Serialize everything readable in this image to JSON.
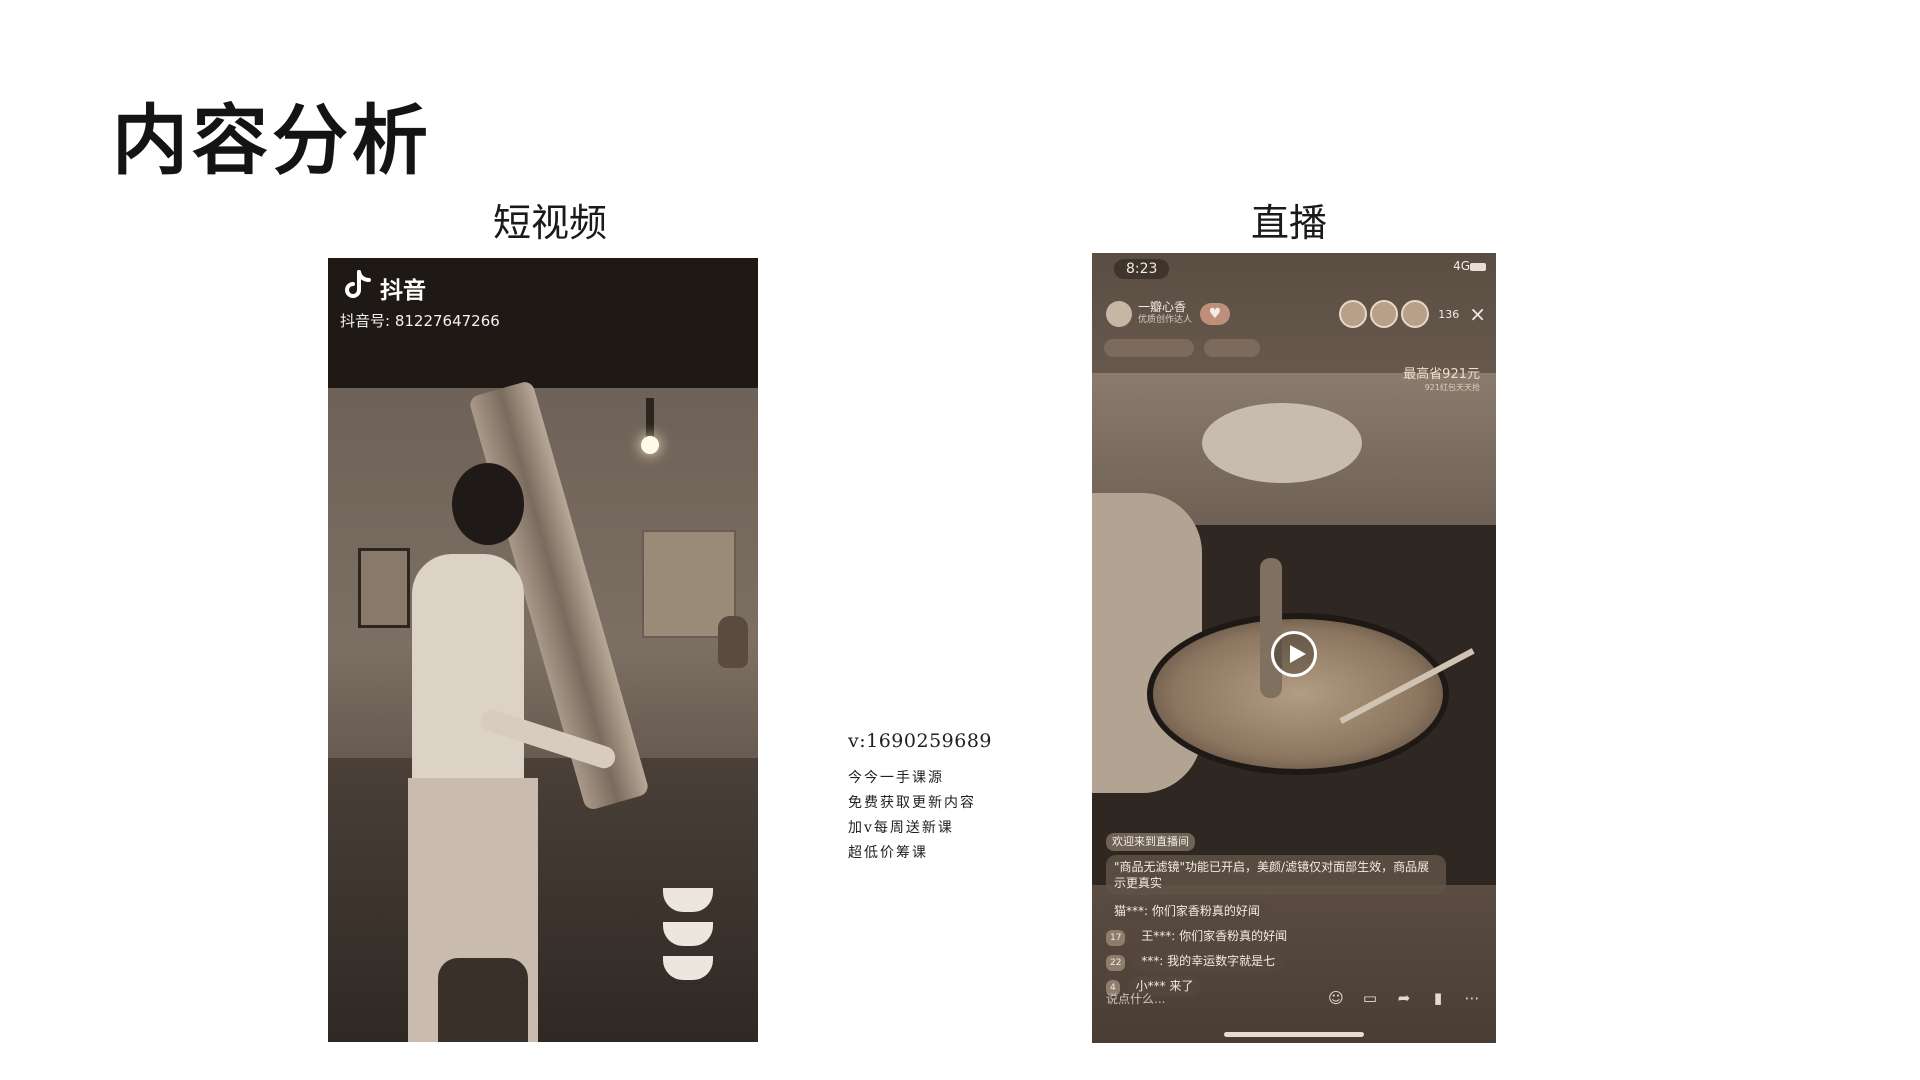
{
  "slide": {
    "title": "内容分析",
    "short_video_label": "短视频",
    "live_label": "直播"
  },
  "short_video": {
    "brand": "抖音",
    "account_id": "抖音号: 81227647266"
  },
  "watermark": {
    "phone": "v:1690259689",
    "lines": [
      "今今一手课源",
      "免费获取更新内容",
      "加v每周送新课",
      "超低价筹课"
    ]
  },
  "live_stream": {
    "status_time": "8:23",
    "network": "4G",
    "host_name": "一瓣心香",
    "host_sub": "优质创作达人",
    "viewer_count": "136",
    "promo_title": "最高省921元",
    "promo_sub": "921红包天天抢",
    "notice_tag": "欢迎来到直播间",
    "notice": "\"商品无滤镜\"功能已开启，美颜/滤镜仅对面部生效，商品展示更真实",
    "comments": [
      {
        "badge": "",
        "text": "猫***: 你们家香粉真的好闻"
      },
      {
        "badge": "17",
        "text": "王***: 你们家香粉真的好闻"
      },
      {
        "badge": "22",
        "text": "***: 我的幸运数字就是七"
      },
      {
        "badge": "4",
        "text": "小*** 来了"
      }
    ],
    "input_placeholder": "说点什么..."
  },
  "icons": {
    "tiktok": "tiktok-logo-icon",
    "play": "play-icon",
    "close": "close-icon",
    "emoji": "emoji-icon",
    "cart": "cart-icon",
    "share": "share-icon",
    "gift": "gift-icon",
    "more": "more-icon"
  },
  "colors": {
    "title": "#141414",
    "background": "#ffffff",
    "sepia_dark": "#2f2822"
  }
}
